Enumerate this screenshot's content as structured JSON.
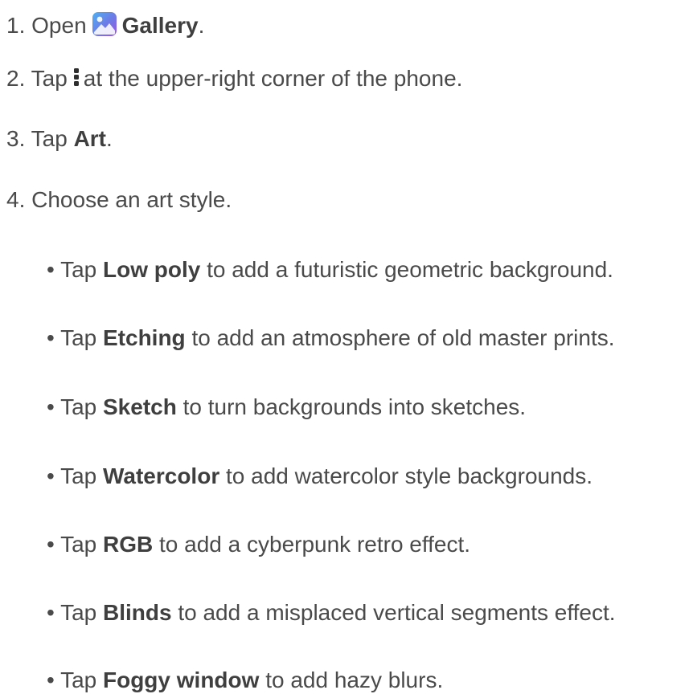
{
  "steps": [
    {
      "num": "1. ",
      "pre": "Open",
      "bold": "Gallery",
      "post": "."
    },
    {
      "num": "2. ",
      "pre": "Tap",
      "post": "at the upper-right corner of the phone."
    },
    {
      "num": "3. ",
      "pre": "Tap ",
      "bold": "Art",
      "post": "."
    },
    {
      "num": "4. ",
      "text": "Choose an art style."
    }
  ],
  "bullets": [
    {
      "prefix": "• Tap ",
      "bold": "Low poly",
      "rest": " to add a futuristic geometric background."
    },
    {
      "prefix": "• Tap ",
      "bold": "Etching",
      "rest": " to add an atmosphere of old master prints."
    },
    {
      "prefix": "• Tap ",
      "bold": "Sketch",
      "rest": " to turn backgrounds into sketches."
    },
    {
      "prefix": "• Tap ",
      "bold": "Watercolor",
      "rest": " to add watercolor style backgrounds."
    },
    {
      "prefix": "• Tap ",
      "bold": "RGB",
      "rest": " to add a cyberpunk retro effect."
    },
    {
      "prefix": "• Tap ",
      "bold": "Blinds",
      "rest": " to add a misplaced vertical segments effect."
    },
    {
      "prefix": "• Tap ",
      "bold": "Foggy window",
      "rest": " to add hazy blurs."
    }
  ],
  "icons": {
    "gallery": "gallery-app-icon",
    "more": "more-vertical-icon"
  },
  "colors": {
    "text": "#4a4a4a",
    "gallery_icon_top": "#5b86e6",
    "gallery_icon_bottom": "#8a5de0"
  }
}
